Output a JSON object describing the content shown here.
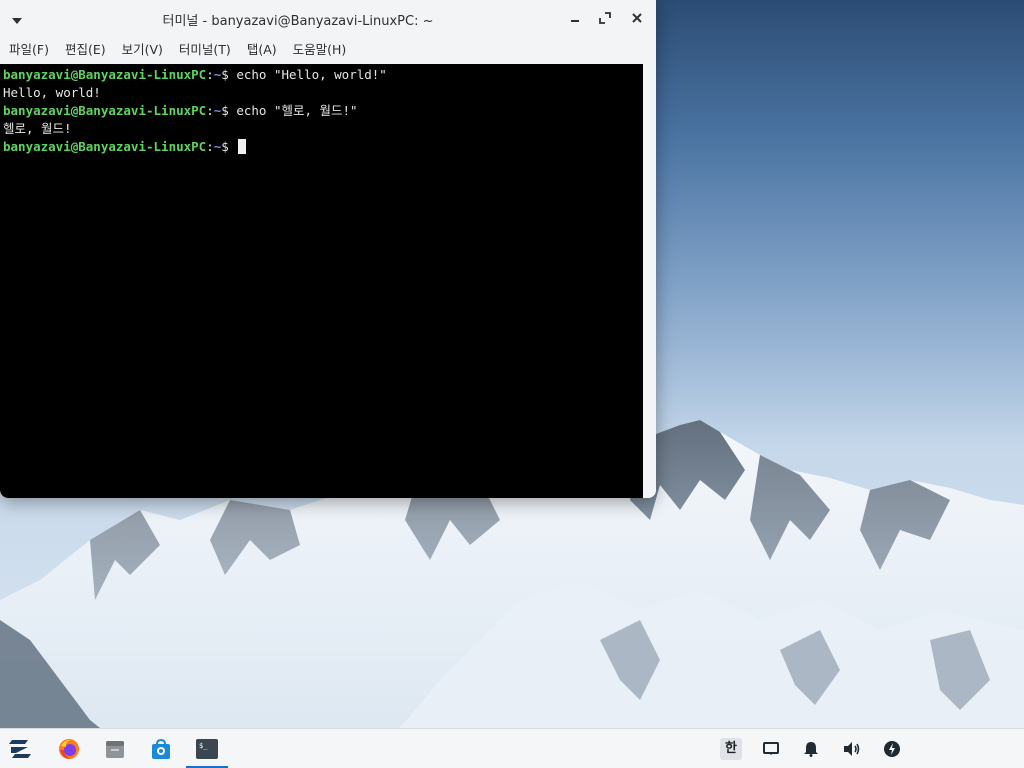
{
  "window": {
    "title": "터미널 - banyazavi@Banyazavi-LinuxPC: ~",
    "menu": [
      {
        "label": "파일(F)"
      },
      {
        "label": "편집(E)"
      },
      {
        "label": "보기(V)"
      },
      {
        "label": "터미널(T)"
      },
      {
        "label": "탭(A)"
      },
      {
        "label": "도움말(H)"
      }
    ]
  },
  "terminal": {
    "prompt_user": "banyazavi@Banyazavi-LinuxPC",
    "prompt_path": "~",
    "prompt_symbol": "$",
    "lines": [
      {
        "command": " echo \"Hello, world!\"",
        "output": "Hello, world!"
      },
      {
        "command": " echo \"헬로, 월드!\"",
        "output": "헬로, 월드!"
      }
    ]
  },
  "taskbar": {
    "ime_label": "한",
    "apps": [
      "zorin-menu-icon",
      "firefox-icon",
      "files-icon",
      "software-store-icon",
      "terminal-icon"
    ],
    "active_app": "terminal-icon",
    "accent": "#1b6fd1"
  }
}
